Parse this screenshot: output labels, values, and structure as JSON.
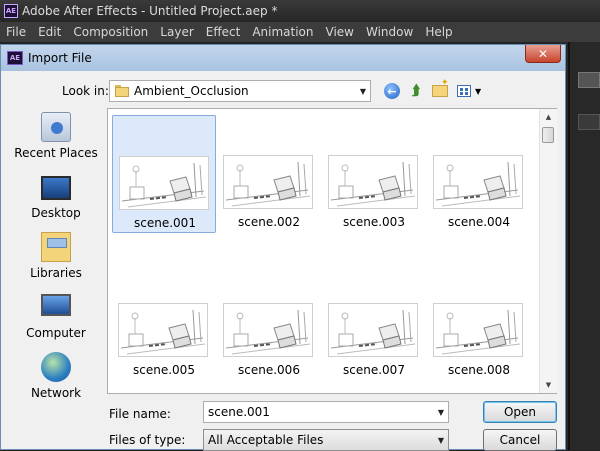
{
  "app": {
    "title": "Adobe After Effects - Untitled Project.aep *",
    "logo_text": "AE",
    "menu": [
      "File",
      "Edit",
      "Composition",
      "Layer",
      "Effect",
      "Animation",
      "View",
      "Window",
      "Help"
    ]
  },
  "dialog": {
    "title": "Import File",
    "logo_text": "AE",
    "close_glyph": "✕",
    "look_in_label": "Look in:",
    "look_in_value": "Ambient_Occlusion",
    "places": [
      "Recent Places",
      "Desktop",
      "Libraries",
      "Computer",
      "Network"
    ],
    "files": [
      {
        "name": "scene.001",
        "selected": true
      },
      {
        "name": "scene.002",
        "selected": false
      },
      {
        "name": "scene.003",
        "selected": false
      },
      {
        "name": "scene.004",
        "selected": false
      },
      {
        "name": "scene.005",
        "selected": false
      },
      {
        "name": "scene.006",
        "selected": false
      },
      {
        "name": "scene.007",
        "selected": false
      },
      {
        "name": "scene.008",
        "selected": false
      }
    ],
    "file_name_label": "File name:",
    "file_name_value": "scene.001",
    "files_of_type_label": "Files of type:",
    "files_of_type_value": "All Acceptable Files",
    "open_label": "Open",
    "cancel_label": "Cancel"
  },
  "colors": {
    "dialog_title_bg": "#b7cde6",
    "close_button": "#c7452d",
    "selection": "#dbe9fb",
    "app_bg": "#232323"
  }
}
